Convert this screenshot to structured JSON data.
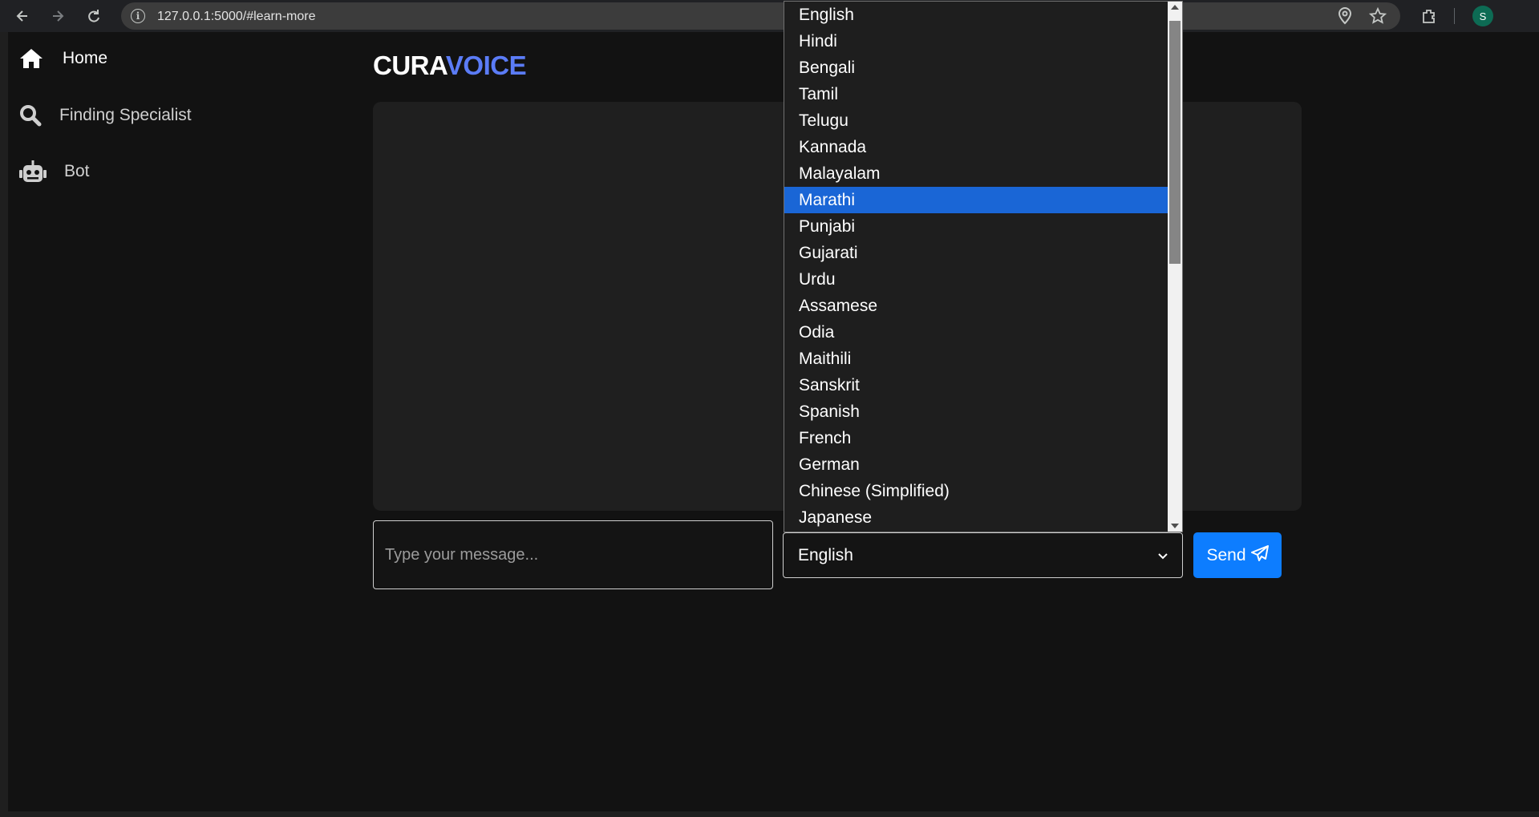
{
  "browser": {
    "url": "127.0.0.1:5000/#learn-more",
    "profile_initial": "S",
    "icons": [
      "back-icon",
      "forward-icon",
      "reload-icon",
      "site-info-icon",
      "location-icon",
      "bookmark-star-icon",
      "extensions-icon"
    ]
  },
  "sidebar": {
    "items": [
      {
        "label": "Home",
        "icon": "home-icon"
      },
      {
        "label": "Finding Specialist",
        "icon": "search-icon"
      },
      {
        "label": "Bot",
        "icon": "robot-icon"
      }
    ]
  },
  "logo": {
    "part1": "CURA",
    "part2": "VOICE",
    "accent_color": "#5b7cf7"
  },
  "chat": {
    "message_placeholder": "Type your message...",
    "selected_language": "English",
    "send_label": "Send",
    "send_color": "#0d7dff"
  },
  "language_dropdown": {
    "highlighted": "Marathi",
    "highlight_color": "#1a66d6",
    "options": [
      "English",
      "Hindi",
      "Bengali",
      "Tamil",
      "Telugu",
      "Kannada",
      "Malayalam",
      "Marathi",
      "Punjabi",
      "Gujarati",
      "Urdu",
      "Assamese",
      "Odia",
      "Maithili",
      "Sanskrit",
      "Spanish",
      "French",
      "German",
      "Chinese (Simplified)",
      "Japanese"
    ]
  }
}
